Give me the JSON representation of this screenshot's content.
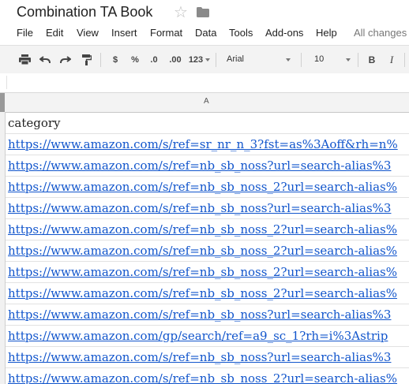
{
  "window": {
    "title": "Combination TA Book"
  },
  "menu": {
    "items": [
      "File",
      "Edit",
      "View",
      "Insert",
      "Format",
      "Data",
      "Tools",
      "Add-ons",
      "Help"
    ],
    "status": "All changes"
  },
  "toolbar": {
    "currency_label": "$",
    "percent_label": "%",
    "decrease_decimals_label": ".0",
    "increase_decimals_label": ".00",
    "more_formats_label": "123",
    "font_family": "Arial",
    "font_size": "10",
    "bold_label": "B",
    "italic_label": "I"
  },
  "sheet": {
    "column_header": "A",
    "rows": [
      "category",
      "https://www.amazon.com/s/ref=sr_nr_n_3?fst=as%3Aoff&rh=n%",
      "https://www.amazon.com/s/ref=nb_sb_noss?url=search-alias%3",
      "https://www.amazon.com/s/ref=nb_sb_noss_2?url=search-alias%",
      "https://www.amazon.com/s/ref=nb_sb_noss?url=search-alias%3",
      "https://www.amazon.com/s/ref=nb_sb_noss_2?url=search-alias%",
      "https://www.amazon.com/s/ref=nb_sb_noss_2?url=search-alias%",
      "https://www.amazon.com/s/ref=nb_sb_noss_2?url=search-alias%",
      "https://www.amazon.com/s/ref=nb_sb_noss_2?url=search-alias%",
      "https://www.amazon.com/s/ref=nb_sb_noss?url=search-alias%3",
      "https://www.amazon.com/gp/search/ref=a9_sc_1?rh=i%3Astrip",
      "https://www.amazon.com/s/ref=nb_sb_noss?url=search-alias%3",
      "https://www.amazon.com/s/ref=nb_sb_noss_2?url=search-alias%"
    ]
  },
  "colors": {
    "link": "#1155cc",
    "toolbar_bg": "#f3f3f3"
  }
}
